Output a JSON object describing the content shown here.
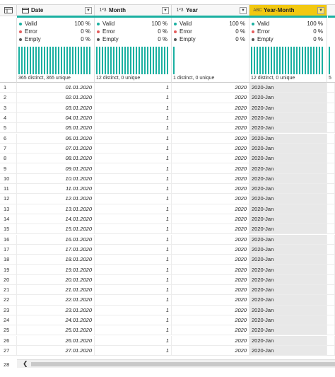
{
  "columns": [
    {
      "key": "date",
      "name": "Date",
      "type_icon": "calendar-icon",
      "type_label": "",
      "selected": false
    },
    {
      "key": "month",
      "name": "Month",
      "type_icon": "int-type-icon",
      "type_label": "1²3",
      "selected": false
    },
    {
      "key": "year",
      "name": "Year",
      "type_icon": "int-type-icon",
      "type_label": "1²3",
      "selected": false
    },
    {
      "key": "year_month",
      "name": "Year-Month",
      "type_icon": "text-type-icon",
      "type_label": "ABC",
      "selected": true
    }
  ],
  "profile_labels": {
    "valid": "Valid",
    "error": "Error",
    "empty": "Empty"
  },
  "profiles": [
    {
      "valid": "100 %",
      "error": "0 %",
      "empty": "0 %",
      "distinct": "365 distinct, 365 unique",
      "bars": 26
    },
    {
      "valid": "100 %",
      "error": "0 %",
      "empty": "0 %",
      "distinct": "12 distinct, 0 unique",
      "bars": 26
    },
    {
      "valid": "100 %",
      "error": "0 %",
      "empty": "0 %",
      "distinct": "1 distinct, 0 unique",
      "bars": 1
    },
    {
      "valid": "100 %",
      "error": "0 %",
      "empty": "0 %",
      "distinct": "12 distinct, 0 unique",
      "bars": 26
    }
  ],
  "truncated_col_distinct": "5",
  "rows": [
    {
      "n": "1",
      "date": "01.01.2020",
      "month": "1",
      "year": "2020",
      "ym": "2020-Jan"
    },
    {
      "n": "2",
      "date": "02.01.2020",
      "month": "1",
      "year": "2020",
      "ym": "2020-Jan"
    },
    {
      "n": "3",
      "date": "03.01.2020",
      "month": "1",
      "year": "2020",
      "ym": "2020-Jan"
    },
    {
      "n": "4",
      "date": "04.01.2020",
      "month": "1",
      "year": "2020",
      "ym": "2020-Jan"
    },
    {
      "n": "5",
      "date": "05.01.2020",
      "month": "1",
      "year": "2020",
      "ym": "2020-Jan"
    },
    {
      "n": "6",
      "date": "06.01.2020",
      "month": "1",
      "year": "2020",
      "ym": "2020-Jan"
    },
    {
      "n": "7",
      "date": "07.01.2020",
      "month": "1",
      "year": "2020",
      "ym": "2020-Jan"
    },
    {
      "n": "8",
      "date": "08.01.2020",
      "month": "1",
      "year": "2020",
      "ym": "2020-Jan"
    },
    {
      "n": "9",
      "date": "09.01.2020",
      "month": "1",
      "year": "2020",
      "ym": "2020-Jan"
    },
    {
      "n": "10",
      "date": "10.01.2020",
      "month": "1",
      "year": "2020",
      "ym": "2020-Jan"
    },
    {
      "n": "11",
      "date": "11.01.2020",
      "month": "1",
      "year": "2020",
      "ym": "2020-Jan"
    },
    {
      "n": "12",
      "date": "12.01.2020",
      "month": "1",
      "year": "2020",
      "ym": "2020-Jan"
    },
    {
      "n": "13",
      "date": "13.01.2020",
      "month": "1",
      "year": "2020",
      "ym": "2020-Jan"
    },
    {
      "n": "14",
      "date": "14.01.2020",
      "month": "1",
      "year": "2020",
      "ym": "2020-Jan"
    },
    {
      "n": "15",
      "date": "15.01.2020",
      "month": "1",
      "year": "2020",
      "ym": "2020-Jan"
    },
    {
      "n": "16",
      "date": "16.01.2020",
      "month": "1",
      "year": "2020",
      "ym": "2020-Jan"
    },
    {
      "n": "17",
      "date": "17.01.2020",
      "month": "1",
      "year": "2020",
      "ym": "2020-Jan"
    },
    {
      "n": "18",
      "date": "18.01.2020",
      "month": "1",
      "year": "2020",
      "ym": "2020-Jan"
    },
    {
      "n": "19",
      "date": "19.01.2020",
      "month": "1",
      "year": "2020",
      "ym": "2020-Jan"
    },
    {
      "n": "20",
      "date": "20.01.2020",
      "month": "1",
      "year": "2020",
      "ym": "2020-Jan"
    },
    {
      "n": "21",
      "date": "21.01.2020",
      "month": "1",
      "year": "2020",
      "ym": "2020-Jan"
    },
    {
      "n": "22",
      "date": "22.01.2020",
      "month": "1",
      "year": "2020",
      "ym": "2020-Jan"
    },
    {
      "n": "23",
      "date": "23.01.2020",
      "month": "1",
      "year": "2020",
      "ym": "2020-Jan"
    },
    {
      "n": "24",
      "date": "24.01.2020",
      "month": "1",
      "year": "2020",
      "ym": "2020-Jan"
    },
    {
      "n": "25",
      "date": "25.01.2020",
      "month": "1",
      "year": "2020",
      "ym": "2020-Jan"
    },
    {
      "n": "26",
      "date": "26.01.2020",
      "month": "1",
      "year": "2020",
      "ym": "2020-Jan"
    },
    {
      "n": "27",
      "date": "27.01.2020",
      "month": "1",
      "year": "2020",
      "ym": "2020-Jan"
    }
  ],
  "next_row_number": "28",
  "colors": {
    "valid": "#1ab0a1",
    "error": "#e45d5d",
    "empty": "#555555",
    "selected_header": "#f2c811"
  }
}
